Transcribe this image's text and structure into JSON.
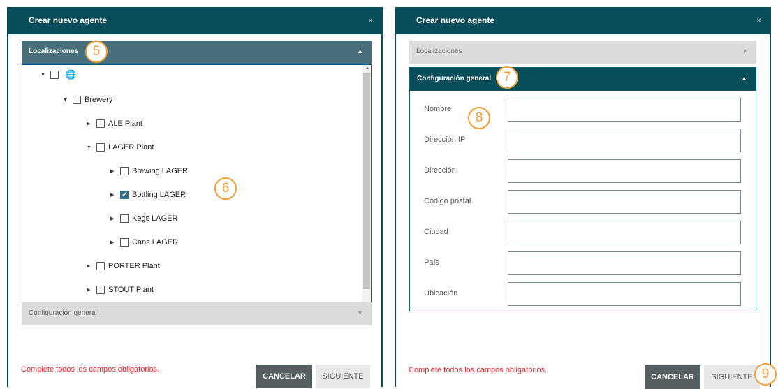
{
  "dialog_left": {
    "title": "Crear nuevo agente",
    "close": "×",
    "acc_locations": {
      "title": "Localizaciones",
      "arrow": "▲"
    },
    "acc_general": {
      "title": "Configuración general",
      "arrow": "▼"
    },
    "tree": {
      "root_icon": "globe-icon",
      "brewery": "Brewery",
      "ale": "ALE Plant",
      "lager": "LAGER Plant",
      "brewing": "Brewing LAGER",
      "bottling": "Bottling LAGER",
      "bottling_checked": true,
      "kegs": "Kegs LAGER",
      "cans": "Cans LAGER",
      "porter": "PORTER Plant",
      "stout": "STOUT Plant"
    },
    "error": "Complete todos los campos obligatorios.",
    "cancel": "CANCELAR",
    "next": "SIGUIENTE"
  },
  "dialog_right": {
    "title": "Crear nuevo agente",
    "close": "×",
    "acc_locations": {
      "title": "Localizaciones",
      "arrow": "▼"
    },
    "acc_general": {
      "title": "Configuración general",
      "arrow": "▲"
    },
    "fields": {
      "nombre": {
        "label": "Nombre",
        "value": ""
      },
      "ip": {
        "label": "Dirección IP",
        "value": ""
      },
      "direccion": {
        "label": "Dirección",
        "value": ""
      },
      "cp": {
        "label": "Código postal",
        "value": ""
      },
      "ciudad": {
        "label": "Ciudad",
        "value": ""
      },
      "pais": {
        "label": "País",
        "value": ""
      },
      "ubicacion": {
        "label": "Ubicación",
        "value": ""
      }
    },
    "error": "Complete todos los campos obligatorios.",
    "cancel": "CANCELAR",
    "next": "SIGUIENTE"
  },
  "badges": {
    "b5": "5",
    "b6": "6",
    "b7": "7",
    "b8": "8",
    "b9": "9"
  },
  "colors": {
    "header": "#074d5a",
    "accordion_active": "#4a6f7c",
    "accordion_inactive": "#dcdcdc",
    "badge": "#f0a038",
    "error": "#e0262b"
  }
}
